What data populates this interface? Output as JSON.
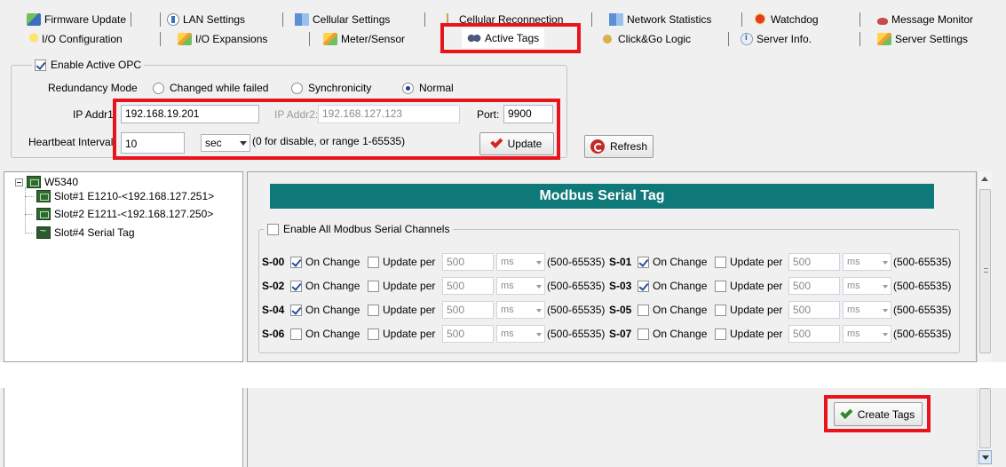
{
  "tabs": {
    "row1": [
      {
        "label": "Firmware Update",
        "icon": "firmware-update-icon"
      },
      {
        "label": "LAN Settings",
        "icon": "lan-settings-icon"
      },
      {
        "label": "Cellular Settings",
        "icon": "cellular-settings-icon"
      },
      {
        "label": "Cellular Reconnection",
        "icon": "cellular-reconnection-icon"
      },
      {
        "label": "Network Statistics",
        "icon": "network-statistics-icon"
      },
      {
        "label": "Watchdog",
        "icon": "watchdog-icon"
      },
      {
        "label": "Message Monitor",
        "icon": "message-monitor-icon"
      }
    ],
    "row2": [
      {
        "label": "I/O Configuration",
        "icon": "bulb-icon"
      },
      {
        "label": "I/O Expansions",
        "icon": "io-expansions-icon"
      },
      {
        "label": "Meter/Sensor",
        "icon": "meter-sensor-icon"
      },
      {
        "label": "Active Tags",
        "icon": "active-tags-icon",
        "selected": true
      },
      {
        "label": "Click&Go Logic",
        "icon": "click-go-icon"
      },
      {
        "label": "Server Info.",
        "icon": "server-info-icon"
      },
      {
        "label": "Server Settings",
        "icon": "server-settings-icon"
      }
    ]
  },
  "opc": {
    "enable_label": "Enable Active OPC",
    "enabled": true,
    "redundancy_label": "Redundancy Mode",
    "modes": [
      "Changed while failed",
      "Synchronicity",
      "Normal"
    ],
    "selected_mode": "Normal",
    "ip1_label": "IP Addr1",
    "ip1_value": "192.168.19.201",
    "ip2_label": "IP Addr2:",
    "ip2_value": "192.168.127.123",
    "port_label": "Port:",
    "port_value": "9900",
    "heartbeat_label": "Heartbeat Interval",
    "heartbeat_value": "10",
    "heartbeat_unit": "sec",
    "heartbeat_hint": "(0 for disable, or range 1-65535)",
    "update_label": "Update",
    "refresh_label": "Refresh"
  },
  "tree": {
    "root": "W5340",
    "children": [
      {
        "label": "Slot#1 E1210-<192.168.127.251>",
        "icon": "io-module-icon"
      },
      {
        "label": "Slot#2 E1211-<192.168.127.250>",
        "icon": "io-module-icon"
      },
      {
        "label": "Slot#4 Serial Tag",
        "icon": "serial-tag-icon"
      }
    ]
  },
  "modbus": {
    "title": "Modbus Serial Tag",
    "enable_all_label": "Enable All Modbus Serial Channels",
    "on_change_label": "On Change",
    "update_per_label": "Update per",
    "interval_value": "500",
    "interval_unit": "ms",
    "range_label": "(500-65535)",
    "channels": [
      {
        "id": "S-00",
        "on_change": true
      },
      {
        "id": "S-01",
        "on_change": true
      },
      {
        "id": "S-02",
        "on_change": true
      },
      {
        "id": "S-03",
        "on_change": true
      },
      {
        "id": "S-04",
        "on_change": true
      },
      {
        "id": "S-05",
        "on_change": false
      },
      {
        "id": "S-06",
        "on_change": false
      },
      {
        "id": "S-07",
        "on_change": false
      }
    ],
    "create_label": "Create Tags"
  },
  "colors": {
    "highlight": "#e8141c",
    "banner": "#0f7878",
    "check_green": "#2e8a26"
  }
}
